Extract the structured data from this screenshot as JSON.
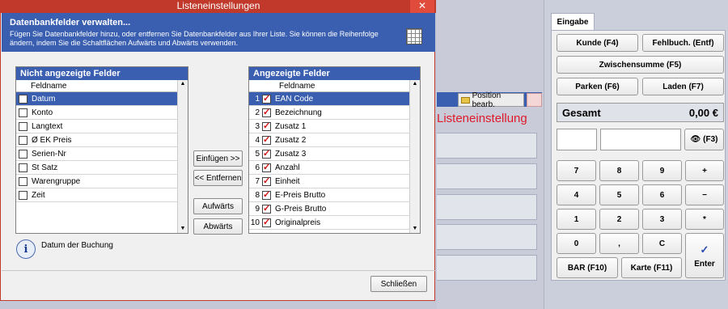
{
  "dialog": {
    "title": "Listeneinstellungen",
    "close_glyph": "✕",
    "header_title": "Datenbankfelder verwalten...",
    "header_desc": "Fügen Sie Datenbankfelder hinzu, oder entfernen Sie Datenbankfelder aus Ihrer Liste. Sie können die Reihenfolge ändern, indem Sie die Schaltflächen Aufwärts und Abwärts verwenden.",
    "left_list": {
      "title": "Nicht angezeigte Felder",
      "column": "Feldname",
      "items": [
        "Datum",
        "Konto",
        "Langtext",
        "Ø EK Preis",
        "Serien-Nr",
        "St Satz",
        "Warengruppe",
        "Zeit"
      ]
    },
    "right_list": {
      "title": "Angezeigte Felder",
      "column": "Feldname",
      "items": [
        {
          "num": "1",
          "label": "EAN Code"
        },
        {
          "num": "2",
          "label": "Bezeichnung"
        },
        {
          "num": "3",
          "label": "Zusatz 1"
        },
        {
          "num": "4",
          "label": "Zusatz 2"
        },
        {
          "num": "5",
          "label": "Zusatz 3"
        },
        {
          "num": "6",
          "label": "Anzahl"
        },
        {
          "num": "7",
          "label": "Einheit"
        },
        {
          "num": "8",
          "label": "E-Preis Brutto"
        },
        {
          "num": "9",
          "label": "G-Preis Brutto"
        },
        {
          "num": "10",
          "label": "Originalpreis"
        }
      ]
    },
    "buttons": {
      "insert": "Einfügen >>",
      "remove": "<< Entfernen",
      "up": "Aufwärts",
      "down": "Abwärts",
      "close": "Schließen"
    },
    "info_text": "Datum der Buchung"
  },
  "background": {
    "position_button": "Position bearb.",
    "red_title": "Listeneinstellung"
  },
  "panel": {
    "tab": "Eingabe",
    "kunde": "Kunde (F4)",
    "fehlbuch": "Fehlbuch. (Entf)",
    "zwischensumme": "Zwischensumme (F5)",
    "parken": "Parken (F6)",
    "laden": "Laden (F7)",
    "gesamt_label": "Gesamt",
    "gesamt_value": "0,00 €",
    "search_button": "(F3)",
    "keys": [
      "7",
      "8",
      "9",
      "+",
      "4",
      "5",
      "6",
      "−",
      "1",
      "2",
      "3",
      "*",
      "0",
      ",",
      "C"
    ],
    "enter": "Enter",
    "bar": "BAR (F10)",
    "karte": "Karte (F11)"
  },
  "colors": {
    "accent_blue": "#3a5fb0",
    "title_red": "#c0392b",
    "text_red": "#e0192a"
  }
}
